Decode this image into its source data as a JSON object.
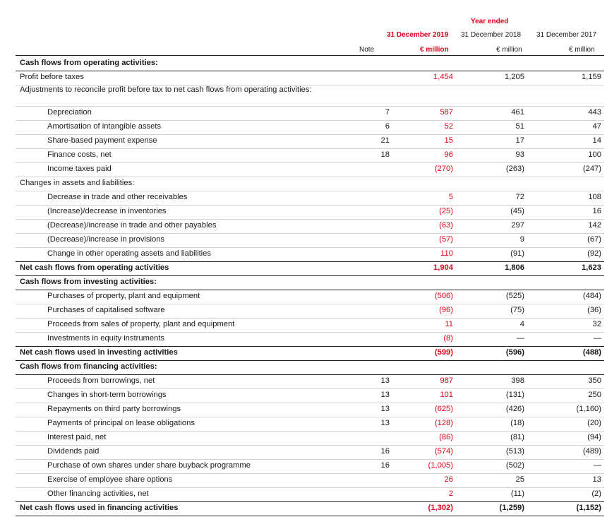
{
  "header": {
    "year_ended": "Year ended",
    "note": "Note",
    "col2019_date": "31 December 2019",
    "col2019_unit": "€ million",
    "col2018_date": "31 December 2018",
    "col2018_unit": "€ million",
    "col2017_date": "31 December 2017",
    "col2017_unit": "€ million"
  },
  "rows": [
    {
      "label": "Cash flows from operating activities:",
      "note": "",
      "v2019": "",
      "v2018": "",
      "v2017": "",
      "style": "section"
    },
    {
      "label": "Profit before taxes",
      "note": "",
      "v2019": "1,454",
      "v2018": "1,205",
      "v2017": "1,159",
      "style": ""
    },
    {
      "label": "Adjustments to reconcile profit before tax to net cash flows from operating activities:",
      "note": "",
      "v2019": "",
      "v2018": "",
      "v2017": "",
      "style": "wrap"
    },
    {
      "label": "Depreciation",
      "note": "7",
      "v2019": "587",
      "v2018": "461",
      "v2017": "443",
      "style": "indent"
    },
    {
      "label": "Amortisation of intangible assets",
      "note": "6",
      "v2019": "52",
      "v2018": "51",
      "v2017": "47",
      "style": "indent"
    },
    {
      "label": "Share-based payment expense",
      "note": "21",
      "v2019": "15",
      "v2018": "17",
      "v2017": "14",
      "style": "indent"
    },
    {
      "label": "Finance costs, net",
      "note": "18",
      "v2019": "96",
      "v2018": "93",
      "v2017": "100",
      "style": "indent"
    },
    {
      "label": "Income taxes paid",
      "note": "",
      "v2019": "(270)",
      "v2018": "(263)",
      "v2017": "(247)",
      "style": "indent"
    },
    {
      "label": "Changes in assets and liabilities:",
      "note": "",
      "v2019": "",
      "v2018": "",
      "v2017": "",
      "style": ""
    },
    {
      "label": "Decrease in trade and other receivables",
      "note": "",
      "v2019": "5",
      "v2018": "72",
      "v2017": "108",
      "style": "indent"
    },
    {
      "label": "(Increase)/decrease in inventories",
      "note": "",
      "v2019": "(25)",
      "v2018": "(45)",
      "v2017": "16",
      "style": "indent"
    },
    {
      "label": "(Decrease)/increase in trade and other payables",
      "note": "",
      "v2019": "(63)",
      "v2018": "297",
      "v2017": "142",
      "style": "indent"
    },
    {
      "label": "(Decrease)/increase in provisions",
      "note": "",
      "v2019": "(57)",
      "v2018": "9",
      "v2017": "(67)",
      "style": "indent"
    },
    {
      "label": "Change in other operating assets and liabilities",
      "note": "",
      "v2019": "110",
      "v2018": "(91)",
      "v2017": "(92)",
      "style": "indent-strong"
    },
    {
      "label": "Net cash flows from operating activities",
      "note": "",
      "v2019": "1,904",
      "v2018": "1,806",
      "v2017": "1,623",
      "style": "total"
    },
    {
      "label": "Cash flows from investing activities:",
      "note": "",
      "v2019": "",
      "v2018": "",
      "v2017": "",
      "style": "section"
    },
    {
      "label": "Purchases of property, plant and equipment",
      "note": "",
      "v2019": "(506)",
      "v2018": "(525)",
      "v2017": "(484)",
      "style": "indent"
    },
    {
      "label": "Purchases of capitalised software",
      "note": "",
      "v2019": "(96)",
      "v2018": "(75)",
      "v2017": "(36)",
      "style": "indent"
    },
    {
      "label": "Proceeds from sales of property, plant and equipment",
      "note": "",
      "v2019": "11",
      "v2018": "4",
      "v2017": "32",
      "style": "indent"
    },
    {
      "label": "Investments in equity instruments",
      "note": "",
      "v2019": "(8)",
      "v2018": "—",
      "v2017": "—",
      "style": "indent-strong"
    },
    {
      "label": "Net cash flows used in investing activities",
      "note": "",
      "v2019": "(599)",
      "v2018": "(596)",
      "v2017": "(488)",
      "style": "total"
    },
    {
      "label": "Cash flows from financing activities:",
      "note": "",
      "v2019": "",
      "v2018": "",
      "v2017": "",
      "style": "section"
    },
    {
      "label": "Proceeds from borrowings, net",
      "note": "13",
      "v2019": "987",
      "v2018": "398",
      "v2017": "350",
      "style": "indent"
    },
    {
      "label": "Changes in short-term borrowings",
      "note": "13",
      "v2019": "101",
      "v2018": "(131)",
      "v2017": "250",
      "style": "indent"
    },
    {
      "label": "Repayments on third party borrowings",
      "note": "13",
      "v2019": "(625)",
      "v2018": "(426)",
      "v2017": "(1,160)",
      "style": "indent"
    },
    {
      "label": "Payments of principal on lease obligations",
      "note": "13",
      "v2019": "(128)",
      "v2018": "(18)",
      "v2017": "(20)",
      "style": "indent"
    },
    {
      "label": "Interest paid, net",
      "note": "",
      "v2019": "(86)",
      "v2018": "(81)",
      "v2017": "(94)",
      "style": "indent"
    },
    {
      "label": "Dividends paid",
      "note": "16",
      "v2019": "(574)",
      "v2018": "(513)",
      "v2017": "(489)",
      "style": "indent"
    },
    {
      "label": "Purchase of own shares under share buyback programme",
      "note": "16",
      "v2019": "(1,005)",
      "v2018": "(502)",
      "v2017": "—",
      "style": "indent"
    },
    {
      "label": "Exercise of employee share options",
      "note": "",
      "v2019": "26",
      "v2018": "25",
      "v2017": "13",
      "style": "indent"
    },
    {
      "label": "Other financing activities, net",
      "note": "",
      "v2019": "2",
      "v2018": "(11)",
      "v2017": "(2)",
      "style": "indent-strong"
    },
    {
      "label": "Net cash flows used in financing activities",
      "note": "",
      "v2019": "(1,302)",
      "v2018": "(1,259)",
      "v2017": "(1,152)",
      "style": "total"
    }
  ],
  "colors": {
    "accent": "#e3001b",
    "text": "#1a1a1a",
    "rule": "#d2d2d2"
  }
}
